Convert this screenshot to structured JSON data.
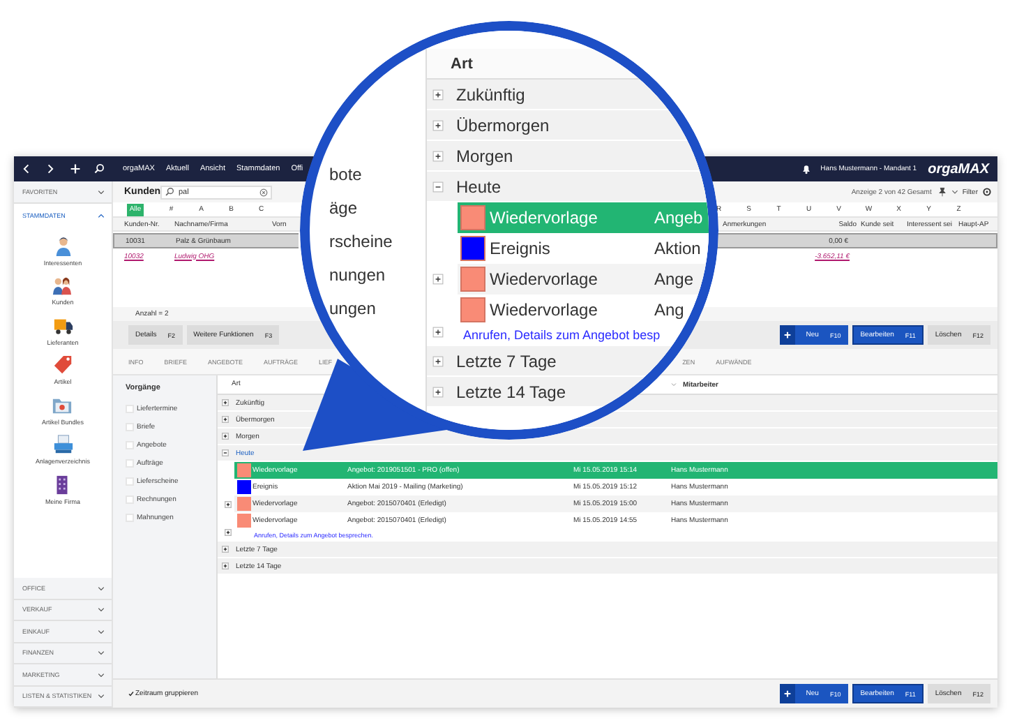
{
  "topbar": {
    "menu": [
      "orgaMAX",
      "Aktuell",
      "Ansicht",
      "Stammdaten",
      "Offi"
    ],
    "user": "Hans Mustermann - Mandant 1",
    "logo": "orgaMAX"
  },
  "sidebar": {
    "favorites": {
      "label": "FAVORITEN",
      "expanded": false
    },
    "stammdaten": {
      "label": "STAMMDATEN",
      "expanded": true,
      "items": [
        {
          "label": "Interessenten",
          "kind": "person"
        },
        {
          "label": "Kunden",
          "kind": "people"
        },
        {
          "label": "Lieferanten",
          "kind": "truck"
        },
        {
          "label": "Artikel",
          "kind": "tag"
        },
        {
          "label": "Artikel Bundles",
          "kind": "folder"
        },
        {
          "label": "Anlagenverzeichnis",
          "kind": "printer"
        },
        {
          "label": "Meine Firma",
          "kind": "building"
        }
      ]
    },
    "sections": [
      {
        "label": "OFFICE",
        "expanded": false
      },
      {
        "label": "VERKAUF",
        "expanded": false
      },
      {
        "label": "EINKAUF",
        "expanded": false
      },
      {
        "label": "FINANZEN",
        "expanded": false
      },
      {
        "label": "MARKETING",
        "expanded": false
      },
      {
        "label": "LISTEN & STATISTIKEN",
        "expanded": false
      }
    ]
  },
  "kunden": {
    "title": "Kunden",
    "search": "pal",
    "count": "Anzeige 2 von 42 Gesamt",
    "filter": "Filter",
    "alphabet_left": [
      {
        "label": "Alle",
        "selected": true
      },
      {
        "label": "#",
        "selected": false
      },
      {
        "label": "A",
        "selected": false
      },
      {
        "label": "B",
        "selected": false
      },
      {
        "label": "C",
        "selected": false
      }
    ],
    "alphabet_right": [
      {
        "label": "R",
        "selected": false
      },
      {
        "label": "S",
        "selected": false
      },
      {
        "label": "T",
        "selected": false
      },
      {
        "label": "U",
        "selected": false
      },
      {
        "label": "V",
        "selected": false
      },
      {
        "label": "W",
        "selected": false
      },
      {
        "label": "X",
        "selected": false
      },
      {
        "label": "Y",
        "selected": false
      },
      {
        "label": "Z",
        "selected": false
      }
    ],
    "columns_left": [
      "Kunden-Nr.",
      "Nachname/Firma",
      "Vorn"
    ],
    "columns_right": [
      "Anmerkungen",
      "Saldo",
      "Kunde seit",
      "Interessent sei",
      "Haupt-AP"
    ],
    "rows": [
      {
        "nr": "10031",
        "name": "Palz & Grünbaum",
        "saldo": "0,00 €",
        "selected": true,
        "kind": "normal"
      },
      {
        "nr": "10032",
        "name": "Ludwig OHG",
        "saldo": "-3.652,11 €",
        "selected": false,
        "kind": "overdue"
      }
    ],
    "summary": "Anzahl = 2"
  },
  "actions": {
    "left": [
      {
        "label": "Details",
        "key": "F2"
      },
      {
        "label": "Weitere Funktionen",
        "key": "F3"
      }
    ],
    "right": [
      {
        "label": "Neu",
        "key": "F10",
        "kind": "new"
      },
      {
        "label": "Bearbeiten",
        "key": "F11",
        "kind": "primary"
      },
      {
        "label": "Löschen",
        "key": "F12",
        "kind": "secondary"
      }
    ]
  },
  "tabs_left": [
    {
      "label": "INFO",
      "selected": false
    },
    {
      "label": "BRIEFE",
      "selected": false
    },
    {
      "label": "ANGEBOTE",
      "selected": false
    },
    {
      "label": "AUFTRÄGE",
      "selected": false
    },
    {
      "label": "LIEF",
      "selected": false
    }
  ],
  "tabs_right": [
    {
      "label": "ZEN",
      "selected": false
    },
    {
      "label": "AUFWÄNDE",
      "selected": false
    }
  ],
  "vorgaenge": {
    "title": "Vorgänge",
    "items": [
      {
        "label": "Liefertermine",
        "checked": false
      },
      {
        "label": "Briefe",
        "checked": false
      },
      {
        "label": "Angebote",
        "checked": false
      },
      {
        "label": "Aufträge",
        "checked": false
      },
      {
        "label": "Lieferscheine",
        "checked": false
      },
      {
        "label": "Rechnungen",
        "checked": false
      },
      {
        "label": "Mahnungen",
        "checked": false
      }
    ]
  },
  "grid": {
    "columns": [
      "Art",
      "Mitarbeiter"
    ],
    "groups": [
      {
        "label": "Zukünftig",
        "expanded": false
      },
      {
        "label": "Übermorgen",
        "expanded": false
      },
      {
        "label": "Morgen",
        "expanded": false
      },
      {
        "label": "Heute",
        "expanded": true,
        "entries": [
          {
            "type": "Wiedervorlage",
            "subject": "Angebot: 2019051501 - PRO (offen)",
            "date": "Mi 15.05.2019 15:14",
            "user": "Hans Mustermann",
            "color": "#f98b76",
            "selected": true,
            "expandable": false
          },
          {
            "type": "Ereignis",
            "subject": "Aktion Mai 2019 - Mailing (Marketing)",
            "date": "Mi 15.05.2019 15:12",
            "user": "Hans Mustermann",
            "color": "#0000ff",
            "selected": false,
            "expandable": false
          },
          {
            "type": "Wiedervorlage",
            "subject": "Angebot: 2015070401 (Erledigt)",
            "date": "Mi 15.05.2019 15:00",
            "user": "Hans Mustermann",
            "color": "#f98b76",
            "selected": false,
            "expandable": true
          },
          {
            "type": "Wiedervorlage",
            "subject": "Angebot: 2015070401 (Erledigt)",
            "date": "Mi 15.05.2019 14:55",
            "user": "Hans Mustermann",
            "color": "#f98b76",
            "selected": false,
            "expandable": true,
            "note": "Anrufen, Details zum Angebot besprechen."
          }
        ]
      },
      {
        "label": "Letzte 7 Tage",
        "expanded": false
      },
      {
        "label": "Letzte 14 Tage",
        "expanded": false
      }
    ]
  },
  "footer": {
    "option": {
      "label": "Zeitraum gruppieren",
      "checked": true
    },
    "buttons": [
      {
        "label": "Neu",
        "key": "F10",
        "kind": "new"
      },
      {
        "label": "Bearbeiten",
        "key": "F11",
        "kind": "primary"
      },
      {
        "label": "Löschen",
        "key": "F12",
        "kind": "secondary"
      }
    ]
  },
  "magnifier": {
    "side_items": [
      "bote",
      "äge",
      "rscheine",
      "nungen",
      "ungen"
    ],
    "header": "Art",
    "groups": [
      {
        "label": "Zukünftig",
        "expanded": false
      },
      {
        "label": "Übermorgen",
        "expanded": false
      },
      {
        "label": "Morgen",
        "expanded": false
      },
      {
        "label": "Heute",
        "expanded": true,
        "entries": [
          {
            "type": "Wiedervorlage",
            "subject": "Angeb",
            "color": "#f98b76",
            "selected": true,
            "expandable": false
          },
          {
            "type": "Ereignis",
            "subject": "Aktion",
            "color": "#0000ff",
            "selected": false,
            "expandable": false
          },
          {
            "type": "Wiedervorlage",
            "subject": "Ange",
            "color": "#f98b76",
            "selected": false,
            "expandable": true
          },
          {
            "type": "Wiedervorlage",
            "subject": "Ang",
            "color": "#f98b76",
            "selected": false,
            "expandable": true,
            "note": "Anrufen, Details zum Angebot besp"
          }
        ]
      },
      {
        "label": "Letzte 7 Tage",
        "expanded": false
      },
      {
        "label": "Letzte 14 Tage",
        "expanded": false
      }
    ]
  }
}
